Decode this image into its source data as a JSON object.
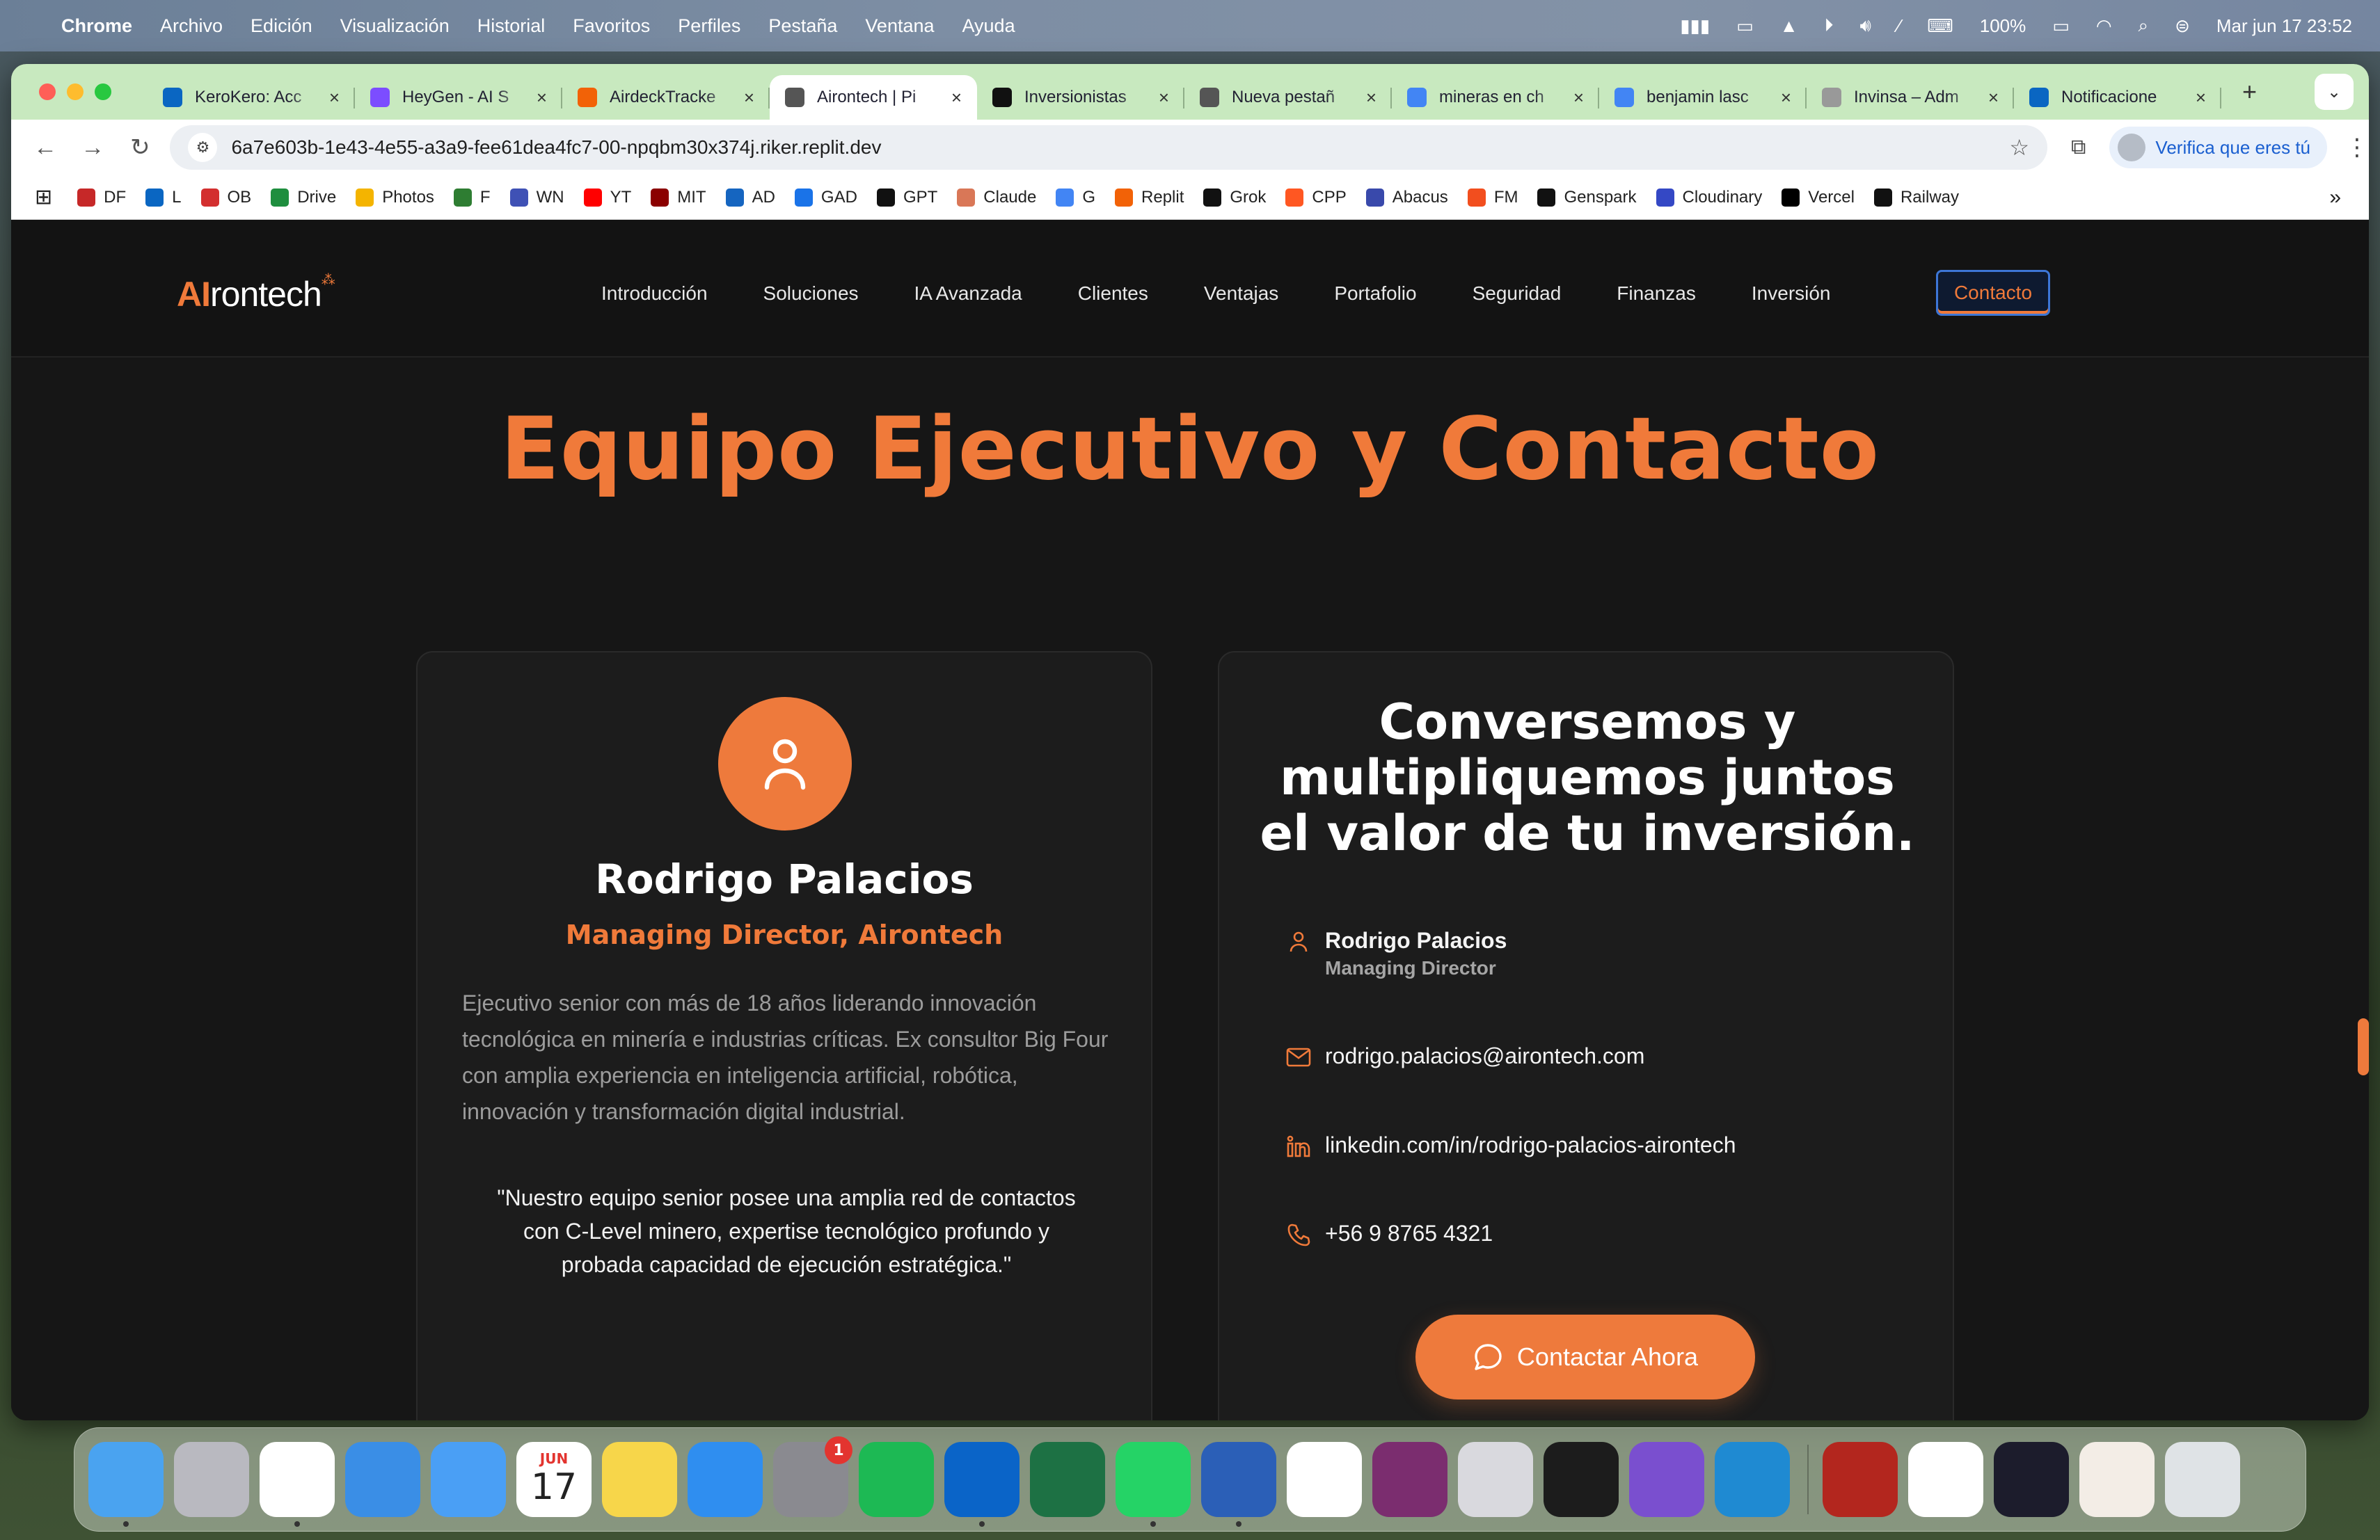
{
  "menubar": {
    "app": "Chrome",
    "items": [
      "Archivo",
      "Edición",
      "Visualización",
      "Historial",
      "Favoritos",
      "Perfiles",
      "Pestaña",
      "Ventana",
      "Ayuda"
    ],
    "battery": "100%",
    "datetime": "Mar jun 17  23:52"
  },
  "tabs": [
    {
      "title": "KeroKero: Acc",
      "icon": "linkedin-icon",
      "color": "#0a66c2"
    },
    {
      "title": "HeyGen - AI S",
      "icon": "heygen-icon",
      "color": "#7c4dff"
    },
    {
      "title": "AirdeckTracke",
      "icon": "replit-icon",
      "color": "#f26207"
    },
    {
      "title": "Airontech | Pi",
      "icon": "globe-icon",
      "color": "#555555",
      "active": true
    },
    {
      "title": "Inversionistas",
      "icon": "openai-icon",
      "color": "#111111"
    },
    {
      "title": "Nueva pestañ",
      "icon": "chrome-icon",
      "color": "#555555"
    },
    {
      "title": "mineras en ch",
      "icon": "google-icon",
      "color": "#4285f4"
    },
    {
      "title": "benjamin lasc",
      "icon": "google-icon",
      "color": "#4285f4"
    },
    {
      "title": "Invinsa – Adm",
      "icon": "invinsa-icon",
      "color": "#999999"
    },
    {
      "title": "Notificacione",
      "icon": "linkedin-icon",
      "color": "#0a66c2"
    }
  ],
  "address_bar": {
    "url": "6a7e603b-1e43-4e55-a3a9-fee61dea4fc7-00-npqbm30x374j.riker.replit.dev",
    "profile_prompt": "Verifica que eres tú"
  },
  "bookmarks": [
    {
      "label": "DF",
      "color": "#c62828"
    },
    {
      "label": "L",
      "color": "#0a66c2"
    },
    {
      "label": "OB",
      "color": "#d32f2f"
    },
    {
      "label": "Drive",
      "color": "#1e8e3e"
    },
    {
      "label": "Photos",
      "color": "#f4b400"
    },
    {
      "label": "F",
      "color": "#2e7d32"
    },
    {
      "label": "WN",
      "color": "#3f51b5"
    },
    {
      "label": "YT",
      "color": "#ff0000"
    },
    {
      "label": "MIT",
      "color": "#8b0000"
    },
    {
      "label": "AD",
      "color": "#1565c0"
    },
    {
      "label": "GAD",
      "color": "#1a73e8"
    },
    {
      "label": "GPT",
      "color": "#111111"
    },
    {
      "label": "Claude",
      "color": "#d97757"
    },
    {
      "label": "G",
      "color": "#4285f4"
    },
    {
      "label": "Replit",
      "color": "#f26207"
    },
    {
      "label": "Grok",
      "color": "#111111"
    },
    {
      "label": "CPP",
      "color": "#ff5722"
    },
    {
      "label": "Abacus",
      "color": "#3949ab"
    },
    {
      "label": "FM",
      "color": "#f24e1e"
    },
    {
      "label": "Genspark",
      "color": "#111111"
    },
    {
      "label": "Cloudinary",
      "color": "#3448c5"
    },
    {
      "label": "Vercel",
      "color": "#000000"
    },
    {
      "label": "Railway",
      "color": "#111111"
    }
  ],
  "site": {
    "logo_ai": "AI",
    "logo_rest": "rontech",
    "nav": [
      "Introducción",
      "Soluciones",
      "IA Avanzada",
      "Clientes",
      "Ventajas",
      "Portafolio",
      "Seguridad",
      "Finanzas",
      "Inversión"
    ],
    "nav_active": "Contacto",
    "accent_color": "#f07a3a",
    "section_title": "Equipo Ejecutivo y Contacto"
  },
  "executive": {
    "name": "Rodrigo Palacios",
    "role": "Managing Director, Airontech",
    "bio": "Ejecutivo senior con más de 18 años liderando innovación tecnológica en minería e industrias críticas. Ex consultor Big Four con amplia experiencia en inteligencia artificial, robótica, innovación y transformación digital industrial.",
    "quote": "\"Nuestro equipo senior posee una amplia red de contactos con C-Level minero, expertise tecnológico profundo y probada capacidad de ejecución estratégica.\""
  },
  "contact": {
    "title": "Conversemos y multipliquemos juntos el valor de tu inversión.",
    "name": "Rodrigo Palacios",
    "title_role": "Managing Director",
    "email": "rodrigo.palacios@airontech.com",
    "linkedin": "linkedin.com/in/rodrigo-palacios-airontech",
    "phone": "+56 9 8765 4321",
    "button": "Contactar Ahora"
  },
  "dock": [
    {
      "name": "finder",
      "color": "#4aa3f0"
    },
    {
      "name": "launchpad",
      "color": "#b9b9c0"
    },
    {
      "name": "chrome",
      "color": "#ffffff"
    },
    {
      "name": "safari",
      "color": "#3a8ee6"
    },
    {
      "name": "mail",
      "color": "#4a9ff5"
    },
    {
      "name": "calendar",
      "color": "#ffffff",
      "month": "JUN",
      "day": "17"
    },
    {
      "name": "notes",
      "color": "#f7d64a"
    },
    {
      "name": "keynote",
      "color": "#2f8ef0"
    },
    {
      "name": "system-settings",
      "color": "#8a8a90",
      "badge": "1"
    },
    {
      "name": "spotify",
      "color": "#1db954"
    },
    {
      "name": "outlook",
      "color": "#0a64c8"
    },
    {
      "name": "excel",
      "color": "#1d7144"
    },
    {
      "name": "whatsapp",
      "color": "#25d366"
    },
    {
      "name": "word",
      "color": "#2b5fb7"
    },
    {
      "name": "fantastical",
      "color": "#ffffff"
    },
    {
      "name": "screen-recorder",
      "color": "#7b2d6f"
    },
    {
      "name": "iphone-mirroring",
      "color": "#d9d9de"
    },
    {
      "name": "replit",
      "color": "#1c1c1c"
    },
    {
      "name": "github-desktop",
      "color": "#7a4fcf"
    },
    {
      "name": "vscode",
      "color": "#1f8ad2"
    },
    {
      "name": "acrobat",
      "color": "#b3261e"
    },
    {
      "name": "notion",
      "color": "#ffffff"
    },
    {
      "name": "webex",
      "color": "#1c1c2c"
    },
    {
      "name": "document-stack",
      "color": "#f3ede6"
    },
    {
      "name": "trash",
      "color": "#dfe3e6"
    }
  ]
}
